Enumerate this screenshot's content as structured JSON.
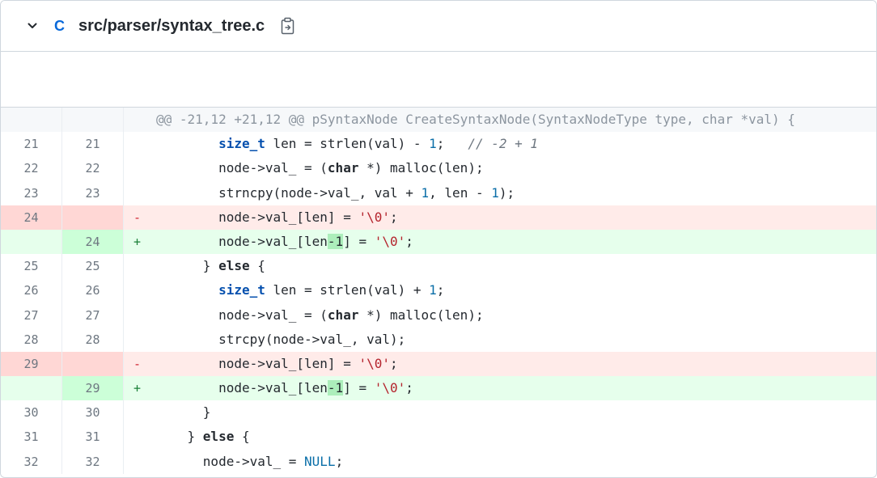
{
  "file": {
    "language_badge": "C",
    "path": "src/parser/syntax_tree.c",
    "collapse_icon": "chevron-down-icon",
    "copy_icon": "copy-path-icon"
  },
  "hunk_header": "@@ -21,12 +21,12 @@ pSyntaxNode CreateSyntaxNode(SyntaxNodeType type, char *val) {",
  "lines": [
    {
      "type": "ctx",
      "old": "21",
      "new": "21",
      "marker": "",
      "indent": "        ",
      "tokens": [
        {
          "t": "size_t",
          "c": "type"
        },
        {
          "t": " len = strlen(val) - "
        },
        {
          "t": "1",
          "c": "numlit"
        },
        {
          "t": ";   "
        },
        {
          "t": "// -2 + 1",
          "c": "cm"
        }
      ]
    },
    {
      "type": "ctx",
      "old": "22",
      "new": "22",
      "marker": "",
      "indent": "        ",
      "tokens": [
        {
          "t": "node->",
          "c": ""
        },
        {
          "t": "val_ = ("
        },
        {
          "t": "char",
          "c": "kw"
        },
        {
          "t": " *) malloc(len);"
        }
      ]
    },
    {
      "type": "ctx",
      "old": "23",
      "new": "23",
      "marker": "",
      "indent": "        ",
      "tokens": [
        {
          "t": "strncpy(node->val_, val + "
        },
        {
          "t": "1",
          "c": "numlit"
        },
        {
          "t": ", len - "
        },
        {
          "t": "1",
          "c": "numlit"
        },
        {
          "t": ");"
        }
      ]
    },
    {
      "type": "del",
      "old": "24",
      "new": "",
      "marker": "-",
      "indent": "        ",
      "tokens": [
        {
          "t": "node->val_[len] = "
        },
        {
          "t": "'\\0'",
          "c": "str"
        },
        {
          "t": ";"
        }
      ]
    },
    {
      "type": "add",
      "old": "",
      "new": "24",
      "marker": "+",
      "indent": "        ",
      "tokens": [
        {
          "t": "node->val_[len"
        },
        {
          "t": "-1",
          "c": "hl"
        },
        {
          "t": "] = "
        },
        {
          "t": "'\\0'",
          "c": "str"
        },
        {
          "t": ";"
        }
      ]
    },
    {
      "type": "ctx",
      "old": "25",
      "new": "25",
      "marker": "",
      "indent": "      ",
      "tokens": [
        {
          "t": "} "
        },
        {
          "t": "else",
          "c": "kw"
        },
        {
          "t": " {"
        }
      ]
    },
    {
      "type": "ctx",
      "old": "26",
      "new": "26",
      "marker": "",
      "indent": "        ",
      "tokens": [
        {
          "t": "size_t",
          "c": "type"
        },
        {
          "t": " len = strlen(val) + "
        },
        {
          "t": "1",
          "c": "numlit"
        },
        {
          "t": ";"
        }
      ]
    },
    {
      "type": "ctx",
      "old": "27",
      "new": "27",
      "marker": "",
      "indent": "        ",
      "tokens": [
        {
          "t": "node->val_ = ("
        },
        {
          "t": "char",
          "c": "kw"
        },
        {
          "t": " *) malloc(len);"
        }
      ]
    },
    {
      "type": "ctx",
      "old": "28",
      "new": "28",
      "marker": "",
      "indent": "        ",
      "tokens": [
        {
          "t": "strcpy(node->val_, val);"
        }
      ]
    },
    {
      "type": "del",
      "old": "29",
      "new": "",
      "marker": "-",
      "indent": "        ",
      "tokens": [
        {
          "t": "node->val_[len] = "
        },
        {
          "t": "'\\0'",
          "c": "str"
        },
        {
          "t": ";"
        }
      ]
    },
    {
      "type": "add",
      "old": "",
      "new": "29",
      "marker": "+",
      "indent": "        ",
      "tokens": [
        {
          "t": "node->val_[len"
        },
        {
          "t": "-1",
          "c": "hl"
        },
        {
          "t": "] = "
        },
        {
          "t": "'\\0'",
          "c": "str"
        },
        {
          "t": ";"
        }
      ]
    },
    {
      "type": "ctx",
      "old": "30",
      "new": "30",
      "marker": "",
      "indent": "      ",
      "tokens": [
        {
          "t": "}"
        }
      ]
    },
    {
      "type": "ctx",
      "old": "31",
      "new": "31",
      "marker": "",
      "indent": "    ",
      "tokens": [
        {
          "t": "} "
        },
        {
          "t": "else",
          "c": "kw"
        },
        {
          "t": " {"
        }
      ]
    },
    {
      "type": "ctx",
      "old": "32",
      "new": "32",
      "marker": "",
      "indent": "      ",
      "tokens": [
        {
          "t": "node->val_ = "
        },
        {
          "t": "NULL",
          "c": "const"
        },
        {
          "t": ";"
        }
      ]
    }
  ]
}
